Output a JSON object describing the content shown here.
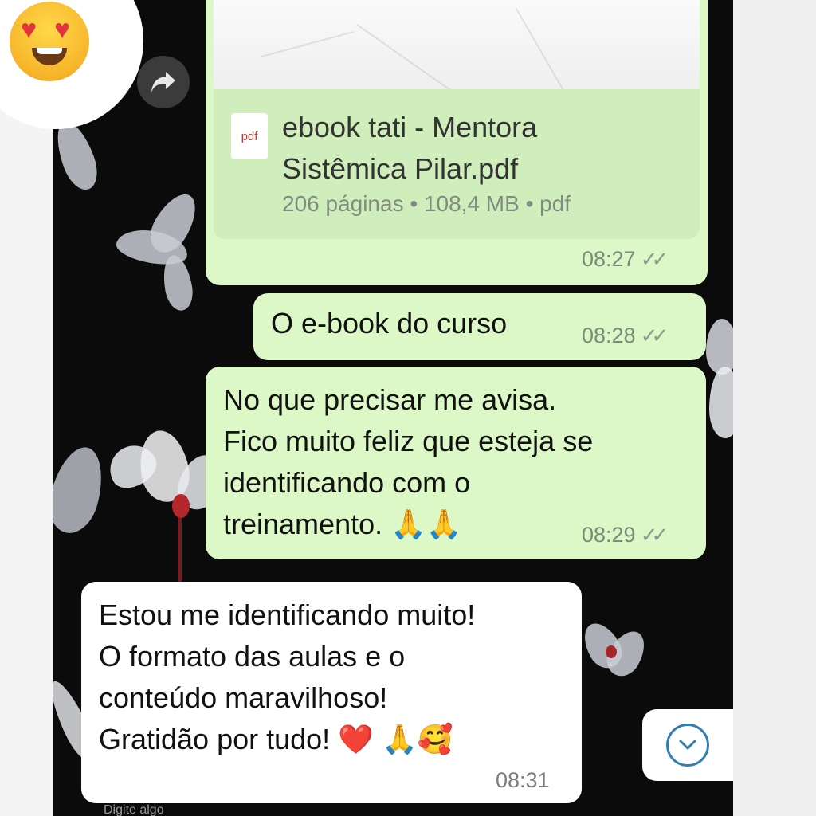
{
  "reaction": {
    "emoji": "😍",
    "icon": "heart-eyes-emoji-icon"
  },
  "document_message": {
    "file_name": "ebook tati - Mentora\nSistêmica Pilar.pdf",
    "file_icon_label": "pdf",
    "file_info": "206 páginas • 108,4 MB • pdf",
    "time": "08:27"
  },
  "messages": [
    {
      "direction": "out",
      "text": "O e-book do curso",
      "time": "08:28"
    },
    {
      "direction": "out",
      "text": "No que precisar me avisa.\nFico muito feliz que esteja se\nidentificando com o\ntreinamento. 🙏🙏",
      "time": "08:29"
    },
    {
      "direction": "in",
      "text": "Estou me identificando muito!\nO formato das aulas e o\nconteúdo maravilhoso!\nGratidão por tudo! ❤️ 🙏🥰",
      "time": "08:31"
    }
  ],
  "input": {
    "placeholder": "Digite algo"
  },
  "colors": {
    "outgoing": "#dcf8c6",
    "incoming": "#ffffff",
    "wallpaper": "#0b0b0b",
    "scroll_icon": "#2f7fb5"
  }
}
